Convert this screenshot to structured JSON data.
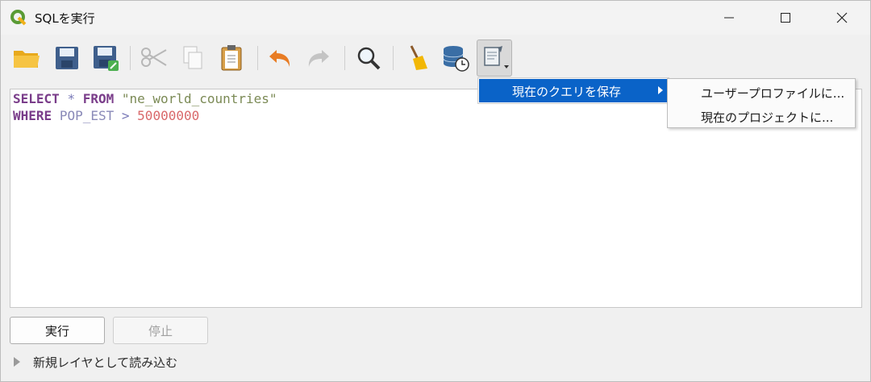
{
  "window": {
    "title": "SQLを実行"
  },
  "toolbar": {
    "buttons": [
      {
        "name": "open-file-icon"
      },
      {
        "name": "save-icon"
      },
      {
        "name": "save-as-icon"
      },
      {
        "name": "cut-icon"
      },
      {
        "name": "copy-icon"
      },
      {
        "name": "paste-icon"
      },
      {
        "name": "undo-icon"
      },
      {
        "name": "redo-icon"
      },
      {
        "name": "find-icon"
      },
      {
        "name": "clear-broom-icon"
      },
      {
        "name": "query-history-icon"
      },
      {
        "name": "stored-queries-icon"
      }
    ]
  },
  "editor": {
    "line1": {
      "kw1": "SELECT",
      "star": "*",
      "kw2": "FROM",
      "table": "\"ne_world_countries\""
    },
    "line2": {
      "kw": "WHERE",
      "field": "POP_EST",
      "op": ">",
      "value": "50000000"
    }
  },
  "menu": {
    "save_current_query": "現在のクエリを保存",
    "submenu": [
      "ユーザープロファイルに...",
      "現在のプロジェクトに..."
    ]
  },
  "buttons": {
    "run": "実行",
    "stop": "停止"
  },
  "load_as_layer": "新規レイヤとして読み込む",
  "colors": {
    "menu_highlight": "#0a63c8",
    "keyword": "#7a3d8a",
    "number": "#d9686a",
    "string": "#7b8a55"
  }
}
